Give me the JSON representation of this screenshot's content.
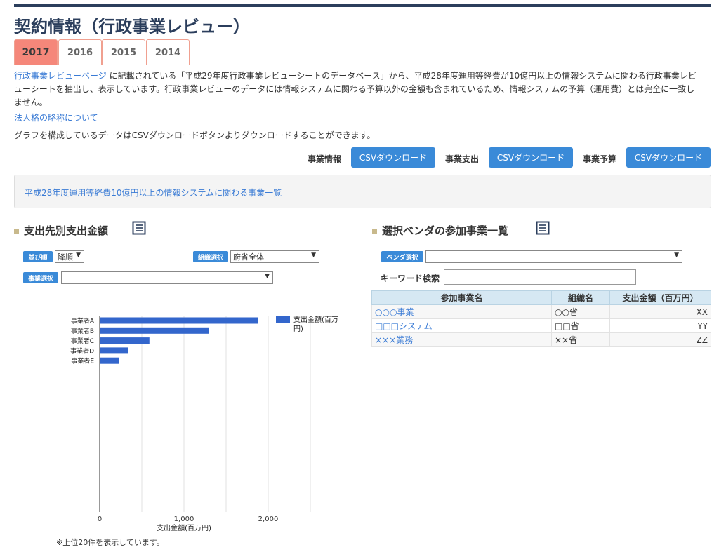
{
  "page": {
    "title": "契約情報（行政事業レビュー）"
  },
  "tabs": [
    "2017",
    "2016",
    "2015",
    "2014"
  ],
  "description": {
    "link_text": "行政事業レビューページ",
    "line1": " に記載されている「平成29年度行政事業レビューシートのデータベース」から、平成28年度運用等経費が10億円以上の情報システムに関わる行政事業レビ",
    "line2": "ューシートを抽出し、表示しています。行政事業レビューのデータには情報システムに関わる予算以外の金額も含まれているため、情報システムの予算（運用費）とは完全に一致し",
    "line3": "ません。"
  },
  "corp_link": "法人格の略称について",
  "csv_note": "グラフを構成しているデータはCSVダウンロードボタンよりダウンロードすることができます。",
  "downloads": [
    {
      "label": "事業情報",
      "button": "CSVダウンロード"
    },
    {
      "label": "事業支出",
      "button": "CSVダウンロード"
    },
    {
      "label": "事業予算",
      "button": "CSVダウンロード"
    }
  ],
  "notice_link": "平成28年度運用等経費10億円以上の情報システムに関わる事業一覧",
  "left_section": {
    "title": "支出先別支出金額",
    "sort_badge": "並び順",
    "sort_value": "降順",
    "org_badge": "組織選択",
    "org_value": "府省全体",
    "project_badge": "事業選択",
    "project_value": "",
    "footnote": "※上位20件を表示しています。"
  },
  "right_section": {
    "title": "選択ベンダの参加事業一覧",
    "vendor_badge": "ベンダ選択",
    "vendor_value": "",
    "keyword_label": "キーワード検索",
    "keyword_value": "",
    "table": {
      "headers": [
        "参加事業名",
        "組織名",
        "支出金額（百万円）"
      ],
      "rows": [
        [
          "○○○事業",
          "○○省",
          "XX"
        ],
        [
          "□□□システム",
          "□□省",
          "YY"
        ],
        [
          "×××業務",
          "××省",
          "ZZ"
        ]
      ]
    }
  },
  "chart_data": {
    "type": "bar",
    "orientation": "horizontal",
    "categories": [
      "事業者A",
      "事業者B",
      "事業者C",
      "事業者D",
      "事業者E"
    ],
    "series": [
      {
        "name": "支出金額(百万円)",
        "values": [
          1880,
          1300,
          590,
          340,
          230
        ]
      }
    ],
    "xlabel": "支出金額(百万円)",
    "xlim": [
      0,
      2500
    ],
    "x_ticks": [
      0,
      1000,
      2000
    ],
    "x_tick_labels": [
      "0",
      "1,000",
      "2,000"
    ],
    "grid": true,
    "legend": "top-right",
    "bar_color": "#3366cc"
  }
}
